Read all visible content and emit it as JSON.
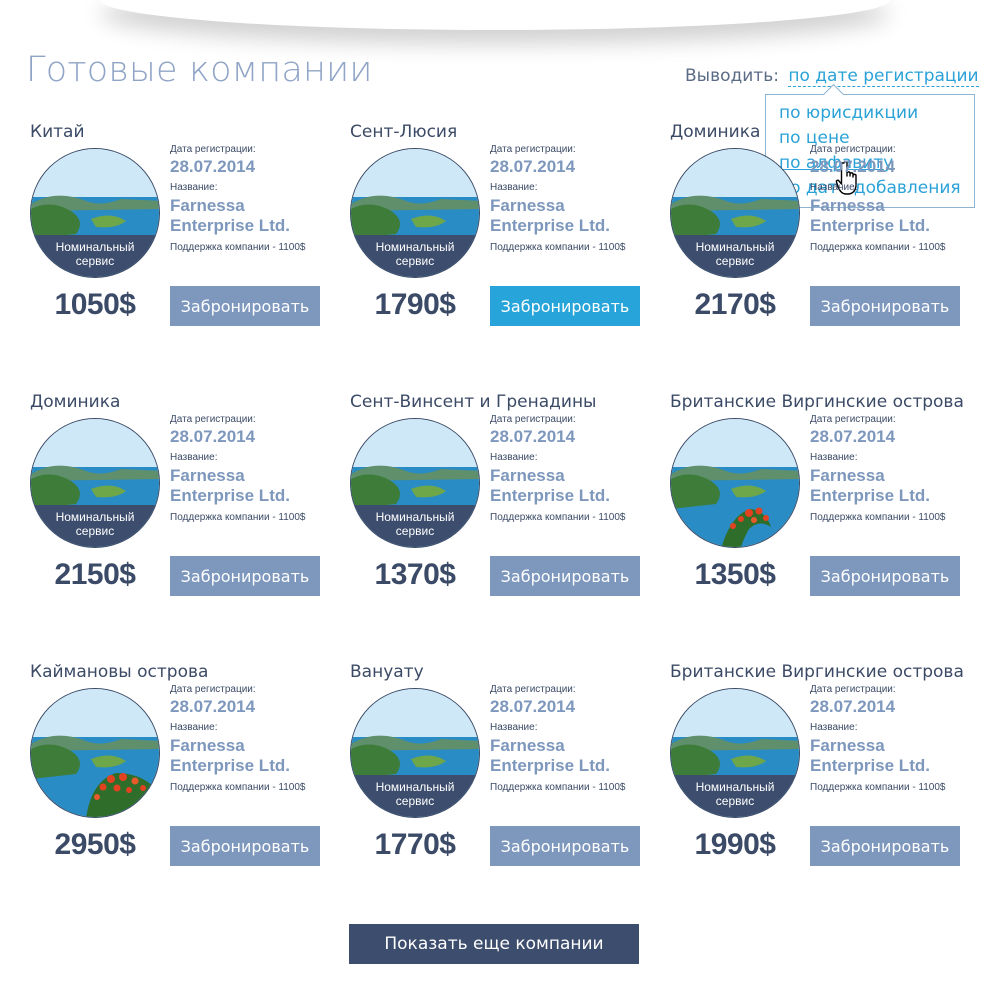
{
  "page_title": "Готовые компании",
  "sort": {
    "label": "Выводить:",
    "current": "по дате регистрации",
    "options": [
      "по юрисдикции",
      "по цене",
      "по алфавиту",
      "по дате добавления"
    ]
  },
  "card_labels": {
    "reg_date_label": "Дата регистрации:",
    "name_label": "Название:",
    "book_button": "Забронировать"
  },
  "cards": [
    {
      "country": "Китай",
      "reg_date": "28.07.2014",
      "name_line1": "Farnessa",
      "name_line2": "Enterprise Ltd.",
      "support": "Поддержка компании - 1100$",
      "price": "1050$",
      "badge_line1": "Номинальный",
      "badge_line2": "сервис"
    },
    {
      "country": "Сент-Люсия",
      "reg_date": "28.07.2014",
      "name_line1": "Farnessa",
      "name_line2": "Enterprise Ltd.",
      "support": "Поддержка компании - 1100$",
      "price": "1790$",
      "badge_line1": "Номинальный",
      "badge_line2": "сервис"
    },
    {
      "country": "Доминика",
      "reg_date": "28.07.2014",
      "name_line1": "Farnessa",
      "name_line2": "Enterprise Ltd.",
      "support": "Поддержка компании - 1100$",
      "price": "2170$",
      "badge_line1": "Номинальный",
      "badge_line2": "сервис"
    },
    {
      "country": "Доминика",
      "reg_date": "28.07.2014",
      "name_line1": "Farnessa",
      "name_line2": "Enterprise Ltd.",
      "support": "Поддержка компании - 1100$",
      "price": "2150$",
      "badge_line1": "Номинальный",
      "badge_line2": "сервис"
    },
    {
      "country": "Сент-Винсент и Гренадины",
      "reg_date": "28.07.2014",
      "name_line1": "Farnessa",
      "name_line2": "Enterprise Ltd.",
      "support": "Поддержка компании - 1100$",
      "price": "1370$",
      "badge_line1": "Номинальный",
      "badge_line2": "сервис"
    },
    {
      "country": "Британские Виргинские острова",
      "reg_date": "28.07.2014",
      "name_line1": "Farnessa",
      "name_line2": "Enterprise Ltd.",
      "support": "Поддержка компании - 1100$",
      "price": "1350$"
    },
    {
      "country": "Каймановы острова",
      "reg_date": "28.07.2014",
      "name_line1": "Farnessa",
      "name_line2": "Enterprise Ltd.",
      "support": "Поддержка компании - 1100$",
      "price": "2950$"
    },
    {
      "country": "Вануату",
      "reg_date": "28.07.2014",
      "name_line1": "Farnessa",
      "name_line2": "Enterprise Ltd.",
      "support": "Поддержка компании - 1100$",
      "price": "1770$",
      "badge_line1": "Номинальный",
      "badge_line2": "сервис"
    },
    {
      "country": "Британские Виргинские острова",
      "reg_date": "28.07.2014",
      "name_line1": "Farnessa",
      "name_line2": "Enterprise Ltd.",
      "support": "Поддержка компании - 1100$",
      "price": "1990$",
      "badge_line1": "Номинальный",
      "badge_line2": "сервис"
    }
  ],
  "more_button": "Показать еще компании",
  "colors": {
    "accent": "#27a4d9",
    "button": "#7d97bd",
    "dark": "#3d4d6d"
  }
}
